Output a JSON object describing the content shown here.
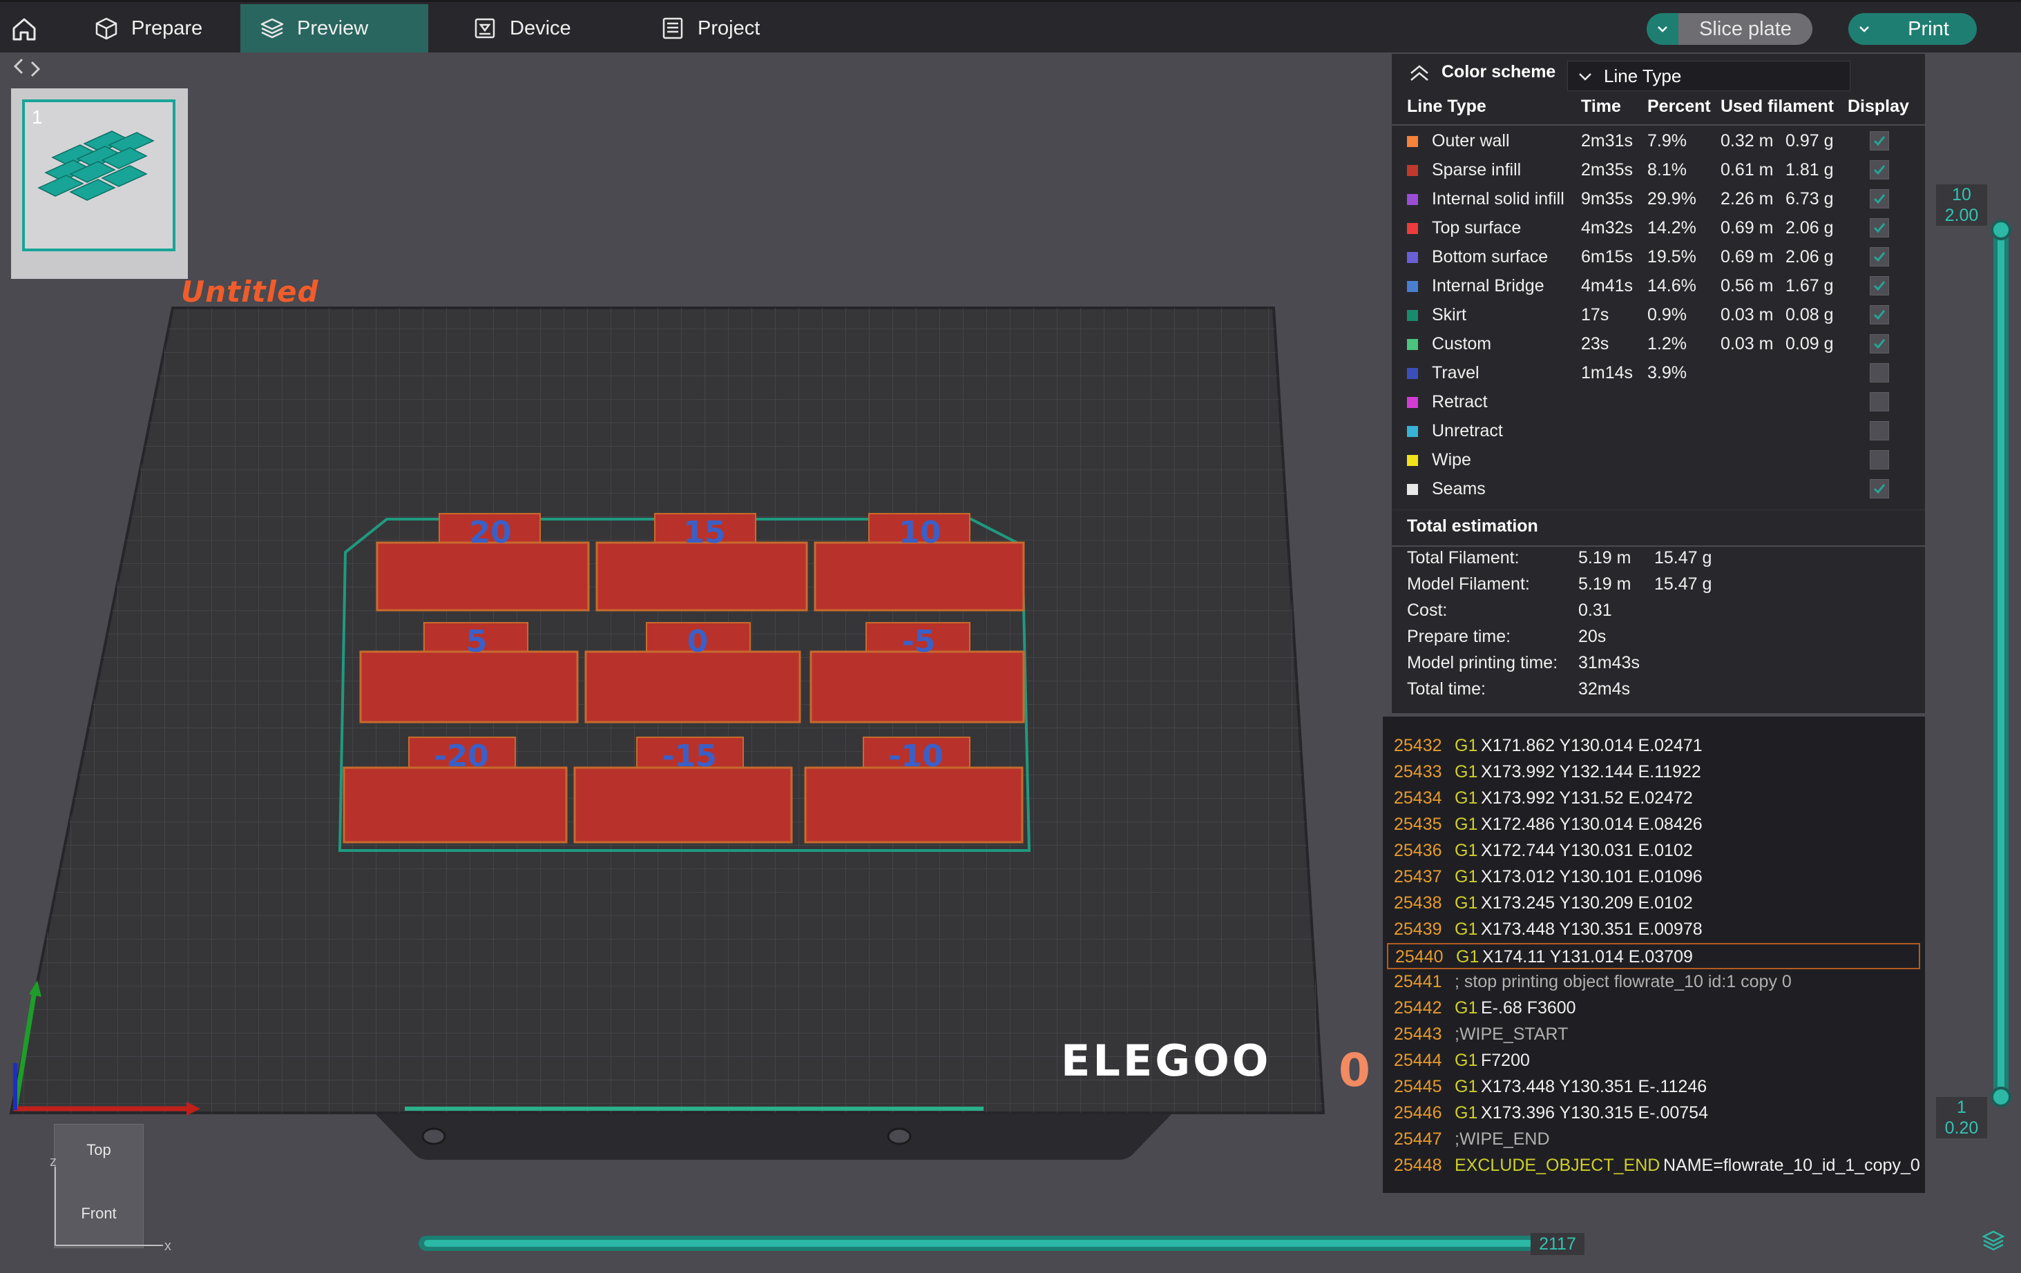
{
  "topbar": {
    "tabs": [
      {
        "label": "Prepare",
        "icon": "cube-icon"
      },
      {
        "label": "Preview",
        "icon": "layers-icon"
      },
      {
        "label": "Device",
        "icon": "device-icon"
      },
      {
        "label": "Project",
        "icon": "project-list-icon"
      }
    ],
    "active_tab": "Preview",
    "slice_label": "Slice plate",
    "print_label": "Print"
  },
  "plate": {
    "number": "1",
    "title": "Untitled"
  },
  "brand_logo": "ELEGOO",
  "part_labels": [
    "20",
    "15",
    "10",
    "5",
    "0",
    "-5",
    "-20",
    "-15",
    "-10"
  ],
  "origin_marker": "0",
  "legend": {
    "title": "Color scheme",
    "scheme": "Line Type",
    "columns": [
      "Line Type",
      "Time",
      "Percent",
      "Used filament",
      "Display"
    ],
    "rows": [
      {
        "name": "Outer wall",
        "color": "#f5813a",
        "time": "2m31s",
        "percent": "7.9%",
        "length": "0.32 m",
        "weight": "0.97 g",
        "checked": true
      },
      {
        "name": "Sparse infill",
        "color": "#c0392b",
        "time": "2m35s",
        "percent": "8.1%",
        "length": "0.61 m",
        "weight": "1.81 g",
        "checked": true
      },
      {
        "name": "Internal solid infill",
        "color": "#9b4dd6",
        "time": "9m35s",
        "percent": "29.9%",
        "length": "2.26 m",
        "weight": "6.73 g",
        "checked": true
      },
      {
        "name": "Top surface",
        "color": "#ee3b3b",
        "time": "4m32s",
        "percent": "14.2%",
        "length": "0.69 m",
        "weight": "2.06 g",
        "checked": true
      },
      {
        "name": "Bottom surface",
        "color": "#6a5fd6",
        "time": "6m15s",
        "percent": "19.5%",
        "length": "0.69 m",
        "weight": "2.06 g",
        "checked": true
      },
      {
        "name": "Internal Bridge",
        "color": "#4a7fd0",
        "time": "4m41s",
        "percent": "14.6%",
        "length": "0.56 m",
        "weight": "1.67 g",
        "checked": true
      },
      {
        "name": "Skirt",
        "color": "#1a8a6e",
        "time": "17s",
        "percent": "0.9%",
        "length": "0.03 m",
        "weight": "0.08 g",
        "checked": true
      },
      {
        "name": "Custom",
        "color": "#4bc47e",
        "time": "23s",
        "percent": "1.2%",
        "length": "0.03 m",
        "weight": "0.09 g",
        "checked": true
      },
      {
        "name": "Travel",
        "color": "#3b4fb8",
        "time": "1m14s",
        "percent": "3.9%",
        "length": "",
        "weight": "",
        "checked": false
      },
      {
        "name": "Retract",
        "color": "#d43bd4",
        "time": "",
        "percent": "",
        "length": "",
        "weight": "",
        "checked": false
      },
      {
        "name": "Unretract",
        "color": "#36b3d6",
        "time": "",
        "percent": "",
        "length": "",
        "weight": "",
        "checked": false
      },
      {
        "name": "Wipe",
        "color": "#f2e21a",
        "time": "",
        "percent": "",
        "length": "",
        "weight": "",
        "checked": false
      },
      {
        "name": "Seams",
        "color": "#e8e8e8",
        "time": "",
        "percent": "",
        "length": "",
        "weight": "",
        "checked": true
      }
    ]
  },
  "totals": {
    "title": "Total estimation",
    "rows": [
      {
        "label": "Total Filament:",
        "v1": "5.19 m",
        "v2": "15.47 g"
      },
      {
        "label": "Model Filament:",
        "v1": "5.19 m",
        "v2": "15.47 g"
      },
      {
        "label": "Cost:",
        "v1": "0.31",
        "v2": ""
      },
      {
        "label": "Prepare time:",
        "v1": "20s",
        "v2": ""
      },
      {
        "label": "Model printing time:",
        "v1": "31m43s",
        "v2": ""
      },
      {
        "label": "Total time:",
        "v1": "32m4s",
        "v2": ""
      }
    ]
  },
  "gcode": [
    {
      "n": "25432",
      "cmd": "G1",
      "args": "X171.862 Y130.014 E.02471"
    },
    {
      "n": "25433",
      "cmd": "G1",
      "args": "X173.992 Y132.144 E.11922"
    },
    {
      "n": "25434",
      "cmd": "G1",
      "args": "X173.992 Y131.52 E.02472"
    },
    {
      "n": "25435",
      "cmd": "G1",
      "args": "X172.486 Y130.014 E.08426"
    },
    {
      "n": "25436",
      "cmd": "G1",
      "args": "X172.744 Y130.031 E.0102"
    },
    {
      "n": "25437",
      "cmd": "G1",
      "args": "X173.012 Y130.101 E.01096"
    },
    {
      "n": "25438",
      "cmd": "G1",
      "args": "X173.245 Y130.209 E.0102"
    },
    {
      "n": "25439",
      "cmd": "G1",
      "args": "X173.448 Y130.351 E.00978"
    },
    {
      "n": "25440",
      "cmd": "G1",
      "args": "X174.11 Y131.014 E.03709",
      "current": true
    },
    {
      "n": "25441",
      "comment": "; stop printing object flowrate_10 id:1 copy 0"
    },
    {
      "n": "25442",
      "cmd": "G1",
      "args": "E-.68 F3600"
    },
    {
      "n": "25443",
      "comment": ";WIPE_START"
    },
    {
      "n": "25444",
      "cmd": "G1",
      "args": "F7200"
    },
    {
      "n": "25445",
      "cmd": "G1",
      "args": "X173.448 Y130.351 E-.11246"
    },
    {
      "n": "25446",
      "cmd": "G1",
      "args": "X173.396 Y130.315 E-.00754"
    },
    {
      "n": "25447",
      "comment": ";WIPE_END"
    },
    {
      "n": "25448",
      "cmd": "EXCLUDE_OBJECT_END",
      "args": "NAME=flowrate_10_id_1_copy_0"
    }
  ],
  "layer_slider": {
    "top_layer": "10",
    "top_height": "2.00",
    "bottom_layer": "1",
    "bottom_height": "0.20"
  },
  "move_slider": {
    "value": "2117"
  },
  "viewcube": {
    "top": "Top",
    "front": "Front",
    "z": "z",
    "x": "x"
  }
}
